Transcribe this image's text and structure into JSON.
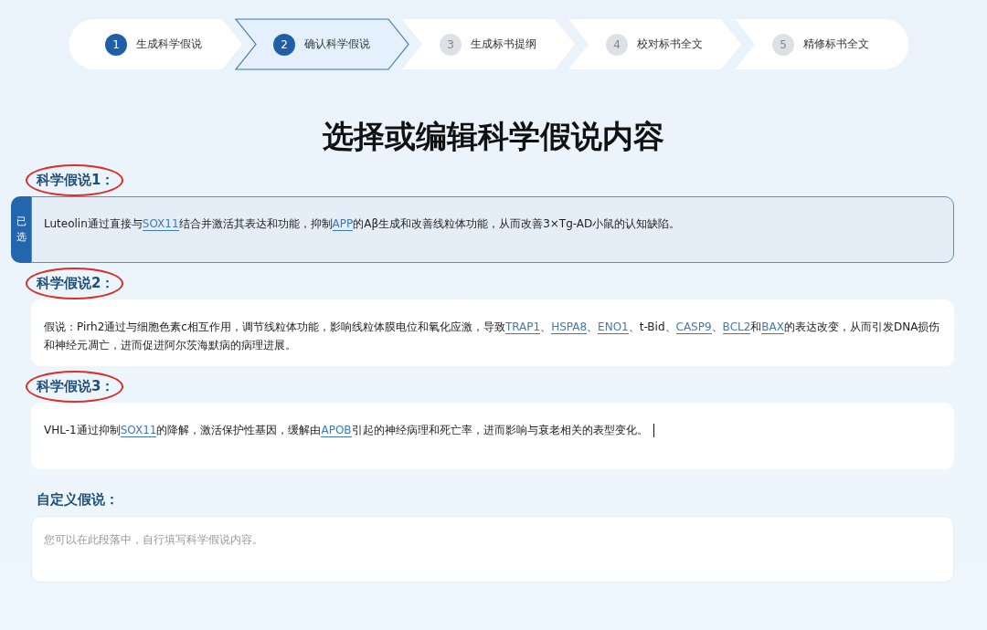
{
  "steps": [
    {
      "number": "1",
      "label": "生成科学假说",
      "selected": false,
      "reached": true
    },
    {
      "number": "2",
      "label": "确认科学假说",
      "selected": true,
      "reached": true
    },
    {
      "number": "3",
      "label": "生成标书提纲",
      "selected": false,
      "reached": false
    },
    {
      "number": "4",
      "label": "校对标书全文",
      "selected": false,
      "reached": false
    },
    {
      "number": "5",
      "label": "精修标书全文",
      "selected": false,
      "reached": false
    }
  ],
  "heading": "选择或编辑科学假说内容",
  "hypotheses": [
    {
      "label": "科学假说1：",
      "circled": true,
      "selected": true,
      "badge": "已选",
      "caret": false,
      "segments": [
        {
          "text": "Luteolin通过直接与",
          "link": false
        },
        {
          "text": "SOX11",
          "link": true
        },
        {
          "text": "结合并激活其表达和功能，抑制",
          "link": false
        },
        {
          "text": "APP",
          "link": true
        },
        {
          "text": "的Aβ生成和改善线粒体功能，从而改善3×Tg-AD小鼠的认知缺陷。",
          "link": false
        }
      ]
    },
    {
      "label": "科学假说2：",
      "circled": true,
      "selected": false,
      "caret": false,
      "segments": [
        {
          "text": "假说：Pirh2通过与细胞色素c相互作用，调节线粒体功能，影响线粒体膜电位和氧化应激，导致",
          "link": false
        },
        {
          "text": "TRAP1",
          "link": true
        },
        {
          "text": "、",
          "link": false
        },
        {
          "text": "HSPA8",
          "link": true
        },
        {
          "text": "、",
          "link": false
        },
        {
          "text": "ENO1",
          "link": true
        },
        {
          "text": "、t-Bid、",
          "link": false
        },
        {
          "text": "CASP9",
          "link": true
        },
        {
          "text": "、",
          "link": false
        },
        {
          "text": "BCL2",
          "link": true
        },
        {
          "text": "和",
          "link": false
        },
        {
          "text": "BAX",
          "link": true
        },
        {
          "text": "的表达改变，从而引发DNA损伤和神经元凋亡，进而促进阿尔茨海默病的病理进展。",
          "link": false
        }
      ]
    },
    {
      "label": "科学假说3：",
      "circled": true,
      "selected": false,
      "caret": true,
      "segments": [
        {
          "text": "VHL-1通过抑制",
          "link": false
        },
        {
          "text": "SOX11",
          "link": true
        },
        {
          "text": "的降解，激活保护性基因，缓解由",
          "link": false
        },
        {
          "text": "APOB",
          "link": true
        },
        {
          "text": "引起的神经病理和死亡率，进而影响与衰老相关的表型变化。",
          "link": false
        }
      ]
    }
  ],
  "custom": {
    "label": "自定义假说：",
    "placeholder": "您可以在此段落中，自行填写科学假说内容。"
  }
}
